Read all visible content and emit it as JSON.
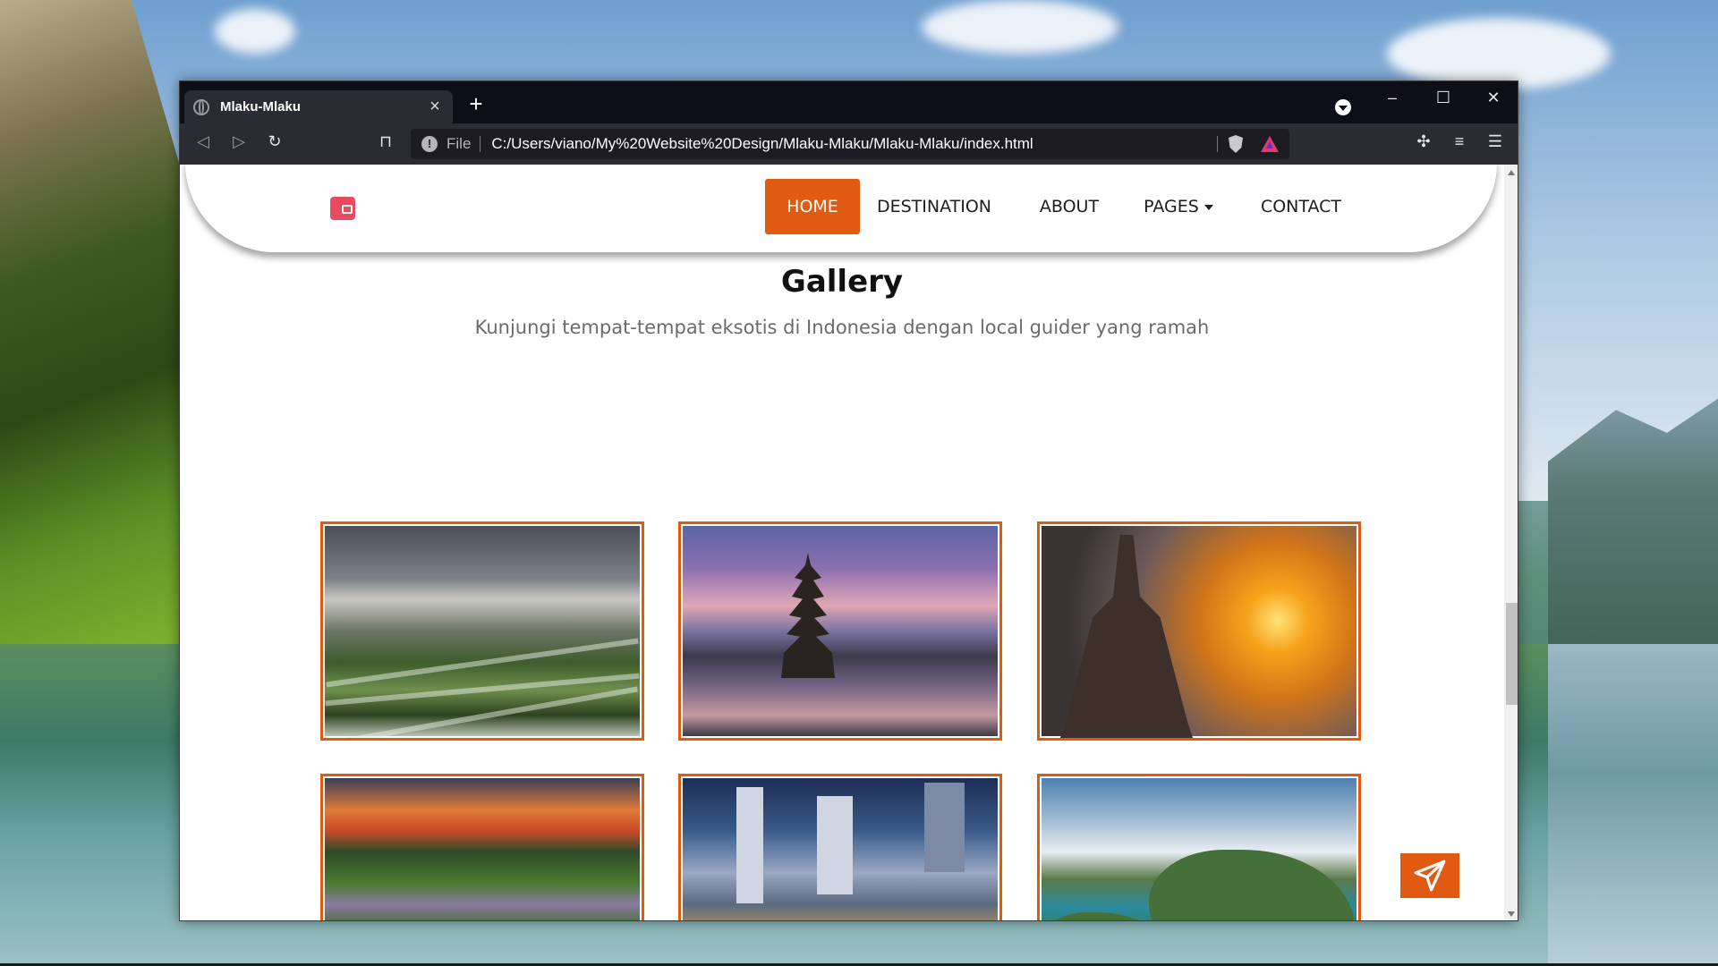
{
  "browser": {
    "tab_title": "Mlaku-Mlaku",
    "tab_close": "×",
    "new_tab": "+",
    "url_scheme_label": "File",
    "url": "C:/Users/viano/My%20Website%20Design/Mlaku-Mlaku/Mlaku-Mlaku/index.html",
    "window_controls": {
      "minimize": "–",
      "maximize": "☐",
      "close": "✕"
    }
  },
  "nav": {
    "items": [
      {
        "label": "HOME",
        "active": true
      },
      {
        "label": "DESTINATION",
        "active": false
      },
      {
        "label": "ABOUT",
        "active": false
      },
      {
        "label": "PAGES",
        "active": false,
        "dropdown": true
      },
      {
        "label": "CONTACT",
        "active": false
      }
    ],
    "accent_color": "#e05a12"
  },
  "gallery": {
    "title": "Gallery",
    "subtitle": "Kunjungi tempat-tempat eksotis di Indonesia dengan local guider yang ramah"
  },
  "icons": {
    "logo": "wallet-icon",
    "send": "paper-plane-icon"
  }
}
